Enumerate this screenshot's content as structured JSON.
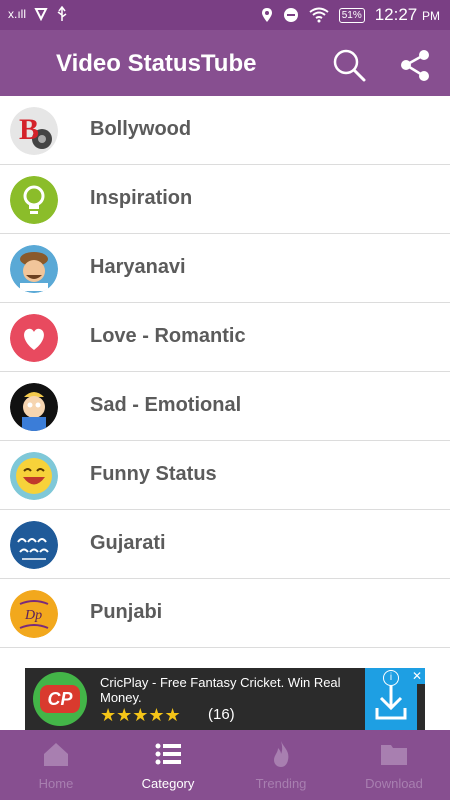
{
  "status_bar": {
    "time": "12:27",
    "ampm": "PM",
    "battery": "51%",
    "signal_label": "x.ıll"
  },
  "app_bar": {
    "title": "Video StatusTube",
    "icons": [
      "search-icon",
      "share-icon"
    ]
  },
  "categories": [
    {
      "label": "Bollywood",
      "icon": "bollywood-logo-icon"
    },
    {
      "label": "Inspiration",
      "icon": "lightbulb-icon"
    },
    {
      "label": "Haryanavi",
      "icon": "haryanavi-man-icon"
    },
    {
      "label": "Love - Romantic",
      "icon": "heart-icon"
    },
    {
      "label": "Sad - Emotional",
      "icon": "sad-cartoon-icon"
    },
    {
      "label": "Funny Status",
      "icon": "laughing-face-icon"
    },
    {
      "label": "Gujarati",
      "icon": "gujarati-status-icon",
      "icon_text": "ગુજરાતી\nસ્ટેટસ"
    },
    {
      "label": "Punjabi",
      "icon": "punjabi-dp-icon",
      "icon_text": "Dp"
    }
  ],
  "ad": {
    "logo_text": "CP",
    "title": "CricPlay - Free Fantasy Cricket. Win Real Money.",
    "stars": "★★★★★",
    "rating_count": "(16)",
    "info": "i",
    "close": "✕"
  },
  "bottom_nav": [
    {
      "label": "Home",
      "icon": "home-icon",
      "active": false
    },
    {
      "label": "Category",
      "icon": "list-icon",
      "active": true
    },
    {
      "label": "Trending",
      "icon": "flame-icon",
      "active": false
    },
    {
      "label": "Download",
      "icon": "folder-icon",
      "active": false
    }
  ],
  "colors": {
    "status_bar": "#7a3f84",
    "app_bar": "#874f90",
    "bottom_nav": "#874f90",
    "list_text": "#5b5b5b",
    "inactive_tab": "#a87fb0"
  }
}
